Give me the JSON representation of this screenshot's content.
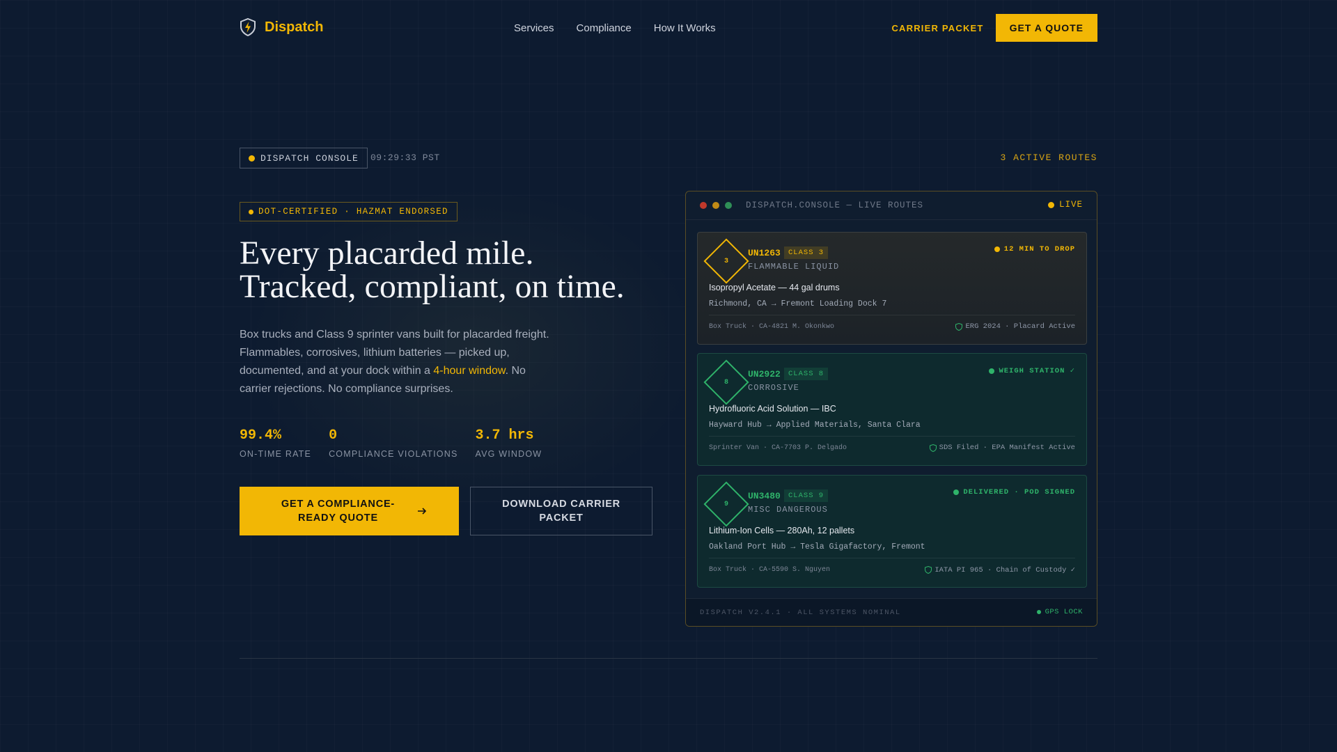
{
  "colors": {
    "accent": "#f2b705",
    "success": "#2fb36a",
    "background": "#0d1b30"
  },
  "nav": {
    "logo_icon": "shield-bolt-icon",
    "brand": "Dispatch",
    "links": [
      "Services",
      "Compliance",
      "How It Works"
    ],
    "carrier_packet": "CARRIER PACKET",
    "get_quote": "GET A QUOTE"
  },
  "console": {
    "badge": "DISPATCH CONSOLE",
    "time": "09:29:33 PST",
    "active_routes": "3 ACTIVE ROUTES"
  },
  "hero": {
    "badge": "DOT-CERTIFIED · HAZMAT ENDORSED",
    "headline_line1": "Every placarded mile.",
    "headline_line2": "Tracked, compliant, on time.",
    "desc_before": "Box trucks and Class 9 sprinter vans built for placarded freight. Flammables, corrosives, lithium batteries — picked up, documented, and at your dock within a ",
    "desc_highlight": "4-hour window",
    "desc_after": ". No carrier rejections. No compliance surprises.",
    "stats": [
      {
        "value": "99.4%",
        "label": "ON-TIME RATE"
      },
      {
        "value": "0",
        "label": "COMPLIANCE VIOLATIONS"
      },
      {
        "value": "3.7 hrs",
        "label": "AVG WINDOW"
      }
    ],
    "cta_primary": "GET A COMPLIANCE-READY QUOTE",
    "cta_primary_icon": "arrow-right-icon",
    "cta_secondary": "DOWNLOAD CARRIER PACKET"
  },
  "panel": {
    "title": "DISPATCH.CONSOLE — LIVE ROUTES",
    "live": "LIVE",
    "routes": [
      {
        "hazard_num": "3",
        "un": "UN1263",
        "class": "CLASS 3",
        "hazard": "FLAMMABLE LIQUID",
        "status": "12 MIN TO DROP",
        "cargo": "Isopropyl Acetate — 44 gal drums",
        "route": "Richmond, CA → Fremont Loading Dock 7",
        "vehicle": "Box Truck · CA-4821  M. Okonkwo",
        "compliance": "ERG 2024 · Placard Active",
        "color": "#f2b705"
      },
      {
        "hazard_num": "8",
        "un": "UN2922",
        "class": "CLASS 8",
        "hazard": "CORROSIVE",
        "status": "WEIGH STATION ✓",
        "cargo": "Hydrofluoric Acid Solution — IBC",
        "route": "Hayward Hub → Applied Materials, Santa Clara",
        "vehicle": "Sprinter Van · CA-7703  P. Delgado",
        "compliance": "SDS Filed · EPA Manifest Active",
        "color": "#2fb36a"
      },
      {
        "hazard_num": "9",
        "un": "UN3480",
        "class": "CLASS 9",
        "hazard": "MISC DANGEROUS",
        "status": "DELIVERED · POD SIGNED",
        "cargo": "Lithium-Ion Cells — 280Ah, 12 pallets",
        "route": "Oakland Port Hub → Tesla Gigafactory, Fremont",
        "vehicle": "Box Truck · CA-5590  S. Nguyen",
        "compliance": "IATA PI 965 · Chain of Custody ✓",
        "color": "#2fb36a"
      }
    ],
    "footer_left": "DISPATCH V2.4.1 · ALL SYSTEMS NOMINAL",
    "footer_right": "GPS LOCK"
  }
}
